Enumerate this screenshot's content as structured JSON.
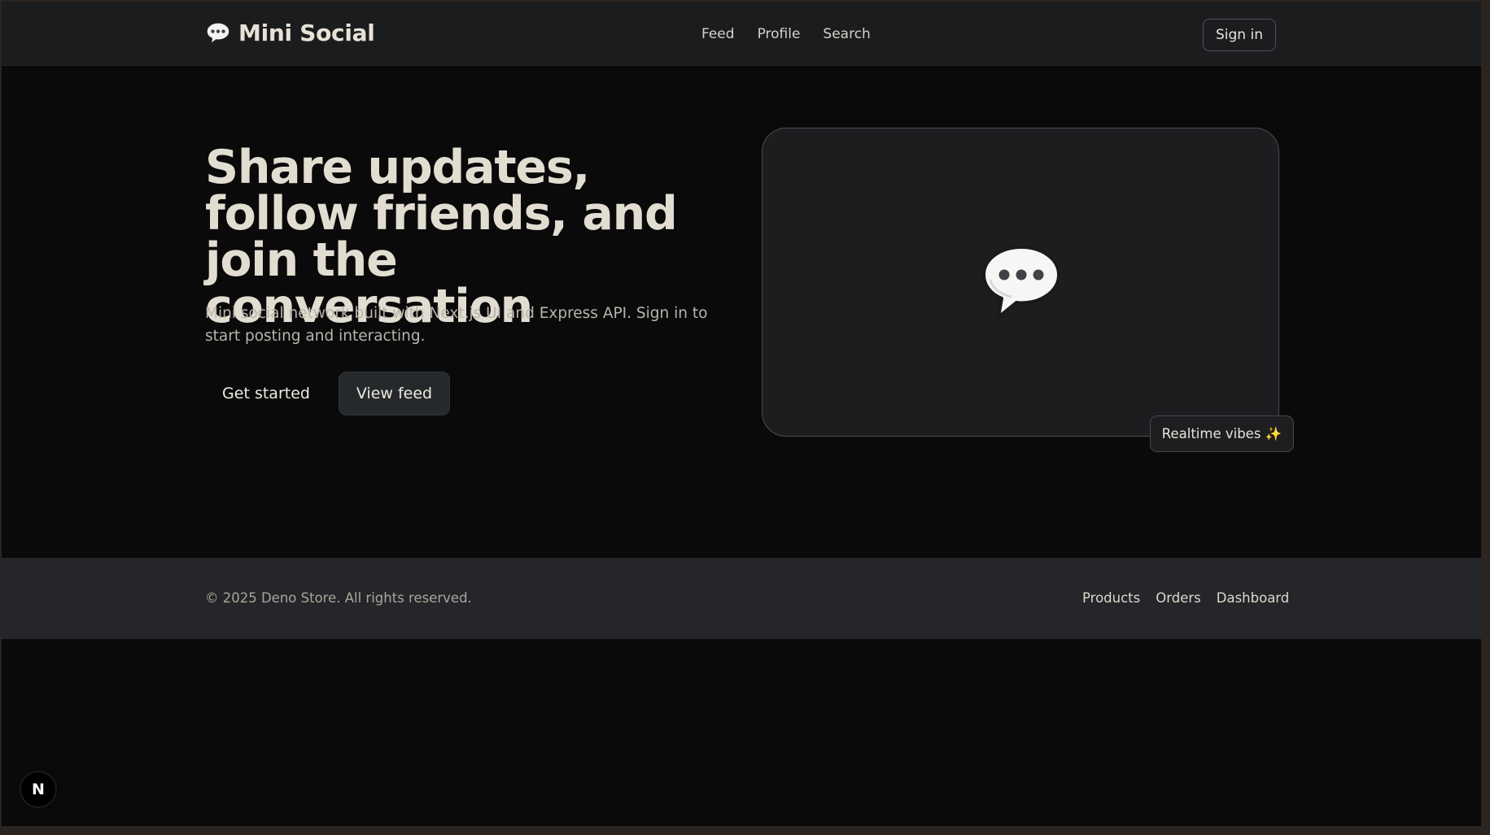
{
  "header": {
    "brand_name": "Mini Social",
    "brand_icon": "speech-bubble-icon",
    "nav": [
      {
        "label": "Feed"
      },
      {
        "label": "Profile"
      },
      {
        "label": "Search"
      }
    ],
    "signin_label": "Sign in"
  },
  "hero": {
    "title": "Share updates, follow friends, and join the conversation",
    "subtitle": "Mini social network built with Next.js UI and Express API. Sign in to start posting and interacting.",
    "primary_button": "Get started",
    "secondary_button": "View feed",
    "card_icon": "speech-bubble-icon",
    "badge_label": "Realtime vibes ✨"
  },
  "footer": {
    "copyright": "© 2025 Deno Store. All rights reserved.",
    "links": [
      {
        "label": "Products"
      },
      {
        "label": "Orders"
      },
      {
        "label": "Dashboard"
      }
    ]
  },
  "devtools": {
    "badge_letter": "N"
  },
  "colors": {
    "background": "#0a0a0b",
    "header_bg": "#1b1c1e",
    "footer_bg": "#242629",
    "card_bg": "#1c1d1f",
    "text_primary": "#e2ddd1"
  }
}
